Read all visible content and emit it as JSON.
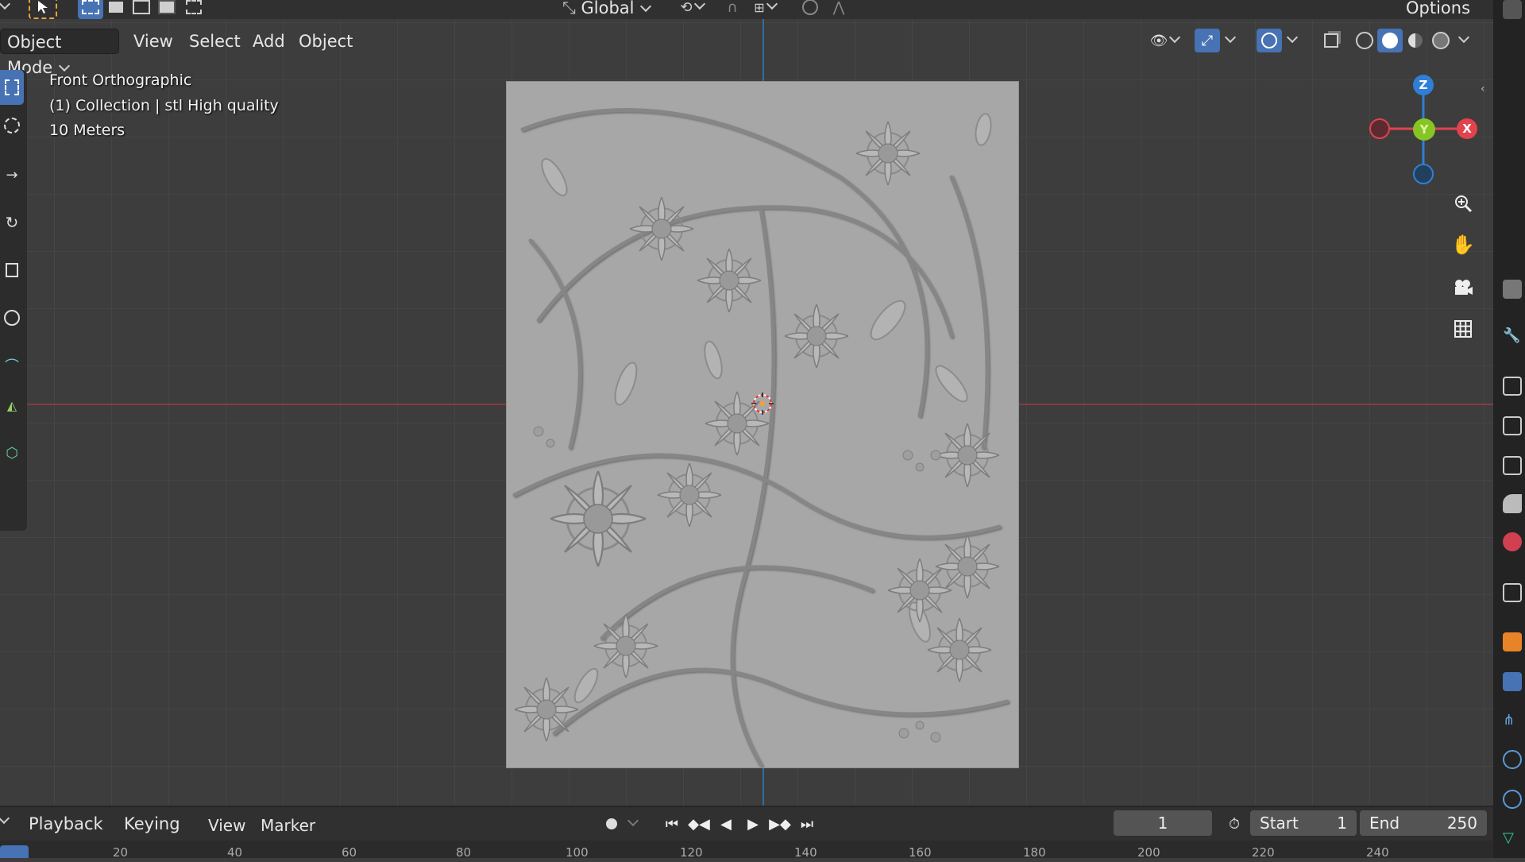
{
  "header": {
    "transform_orientation": "Global",
    "options_label": "Options"
  },
  "menu": {
    "mode": "Object Mode",
    "view": "View",
    "select": "Select",
    "add": "Add",
    "object": "Object"
  },
  "viewport": {
    "view_name": "Front Orthographic",
    "collection_info": "(1) Collection | stl High quality",
    "scale_info": "10 Meters"
  },
  "gizmo": {
    "z_label": "Z",
    "y_label": "Y",
    "x_label": "X",
    "colors": {
      "x": "#e2424e",
      "y": "#86c524",
      "z": "#2f7fd6"
    }
  },
  "timeline": {
    "playback": "Playback",
    "keying": "Keying",
    "view": "View",
    "marker": "Marker",
    "current_frame": "1",
    "start_label": "Start",
    "start_value": "1",
    "end_label": "End",
    "end_value": "250",
    "ruler_ticks": [
      "20",
      "40",
      "60",
      "80",
      "100",
      "120",
      "140",
      "160",
      "180",
      "200",
      "220",
      "240"
    ]
  },
  "icons": [
    "select-cursor-icon",
    "box-select-icon",
    "cursor-icon",
    "move-icon",
    "rotate-icon",
    "scale-icon",
    "transform-icon",
    "annotate-icon",
    "measure-icon",
    "add-cube-icon",
    "zoom-icon",
    "hand-icon",
    "camera-icon",
    "grid-icon",
    "eye-icon",
    "gizmo-icon",
    "overlay-icon",
    "xray-icon",
    "wireframe-icon",
    "solid-icon",
    "material-icon",
    "rendered-icon"
  ]
}
